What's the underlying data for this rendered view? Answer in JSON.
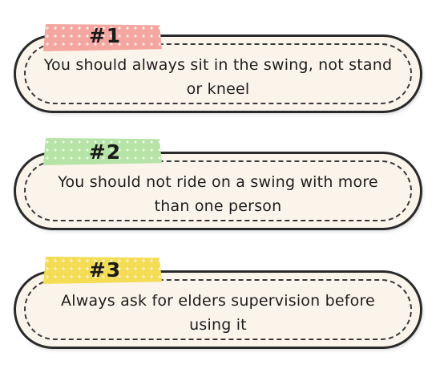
{
  "rules": [
    {
      "number": "#1",
      "text": "You should always sit in the swing, not stand or kneel",
      "tape_color": "#f4a7a1"
    },
    {
      "number": "#2",
      "text": "You should not ride on a swing with more than one person",
      "tape_color": "#b6e3a6"
    },
    {
      "number": "#3",
      "text": "Always ask for elders supervision before using it",
      "tape_color": "#f5dc55"
    }
  ]
}
